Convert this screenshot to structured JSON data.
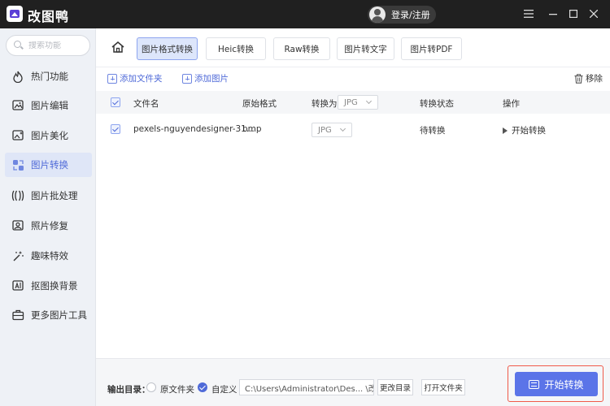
{
  "titlebar": {
    "app_title": "改图鸭",
    "login_label": "登录/注册"
  },
  "sidebar": {
    "search_placeholder": "搜索功能",
    "items": [
      {
        "label": "热门功能",
        "icon": "flame-icon"
      },
      {
        "label": "图片编辑",
        "icon": "image-edit-icon"
      },
      {
        "label": "图片美化",
        "icon": "image-beautify-icon"
      },
      {
        "label": "图片转换",
        "icon": "image-convert-icon",
        "active": true
      },
      {
        "label": "图片批处理",
        "icon": "batch-icon"
      },
      {
        "label": "照片修复",
        "icon": "photo-repair-icon"
      },
      {
        "label": "趣味特效",
        "icon": "magic-wand-icon"
      },
      {
        "label": "抠图换背景",
        "icon": "cutout-icon"
      },
      {
        "label": "更多图片工具",
        "icon": "toolbox-icon"
      }
    ]
  },
  "tabs": [
    {
      "label": "图片格式转换",
      "active": true
    },
    {
      "label": "Heic转换"
    },
    {
      "label": "Raw转换"
    },
    {
      "label": "图片转文字"
    },
    {
      "label": "图片转PDF"
    }
  ],
  "toolbar": {
    "add_folder": "添加文件夹",
    "add_image": "添加图片",
    "remove": "移除"
  },
  "table": {
    "headers": {
      "filename": "文件名",
      "original_format": "原始格式",
      "convert_to": "转换为",
      "convert_to_value": "JPG",
      "status": "转换状态",
      "action": "操作"
    },
    "rows": [
      {
        "filename": "pexels-nguyendesigner-31...",
        "original_format": "bmp",
        "target_format": "JPG",
        "status": "待转换",
        "action": "开始转换"
      }
    ]
  },
  "bottom": {
    "output_label": "输出目录：",
    "option_source": "原文件夹",
    "option_custom": "自定义",
    "path": "C:\\Users\\Administrator\\Des... \\改图鸭",
    "change_dir": "更改目录",
    "open_folder": "打开文件夹",
    "start": "开始转换"
  },
  "colors": {
    "accent": "#5b74e8",
    "highlight_border": "#f05a4a"
  }
}
